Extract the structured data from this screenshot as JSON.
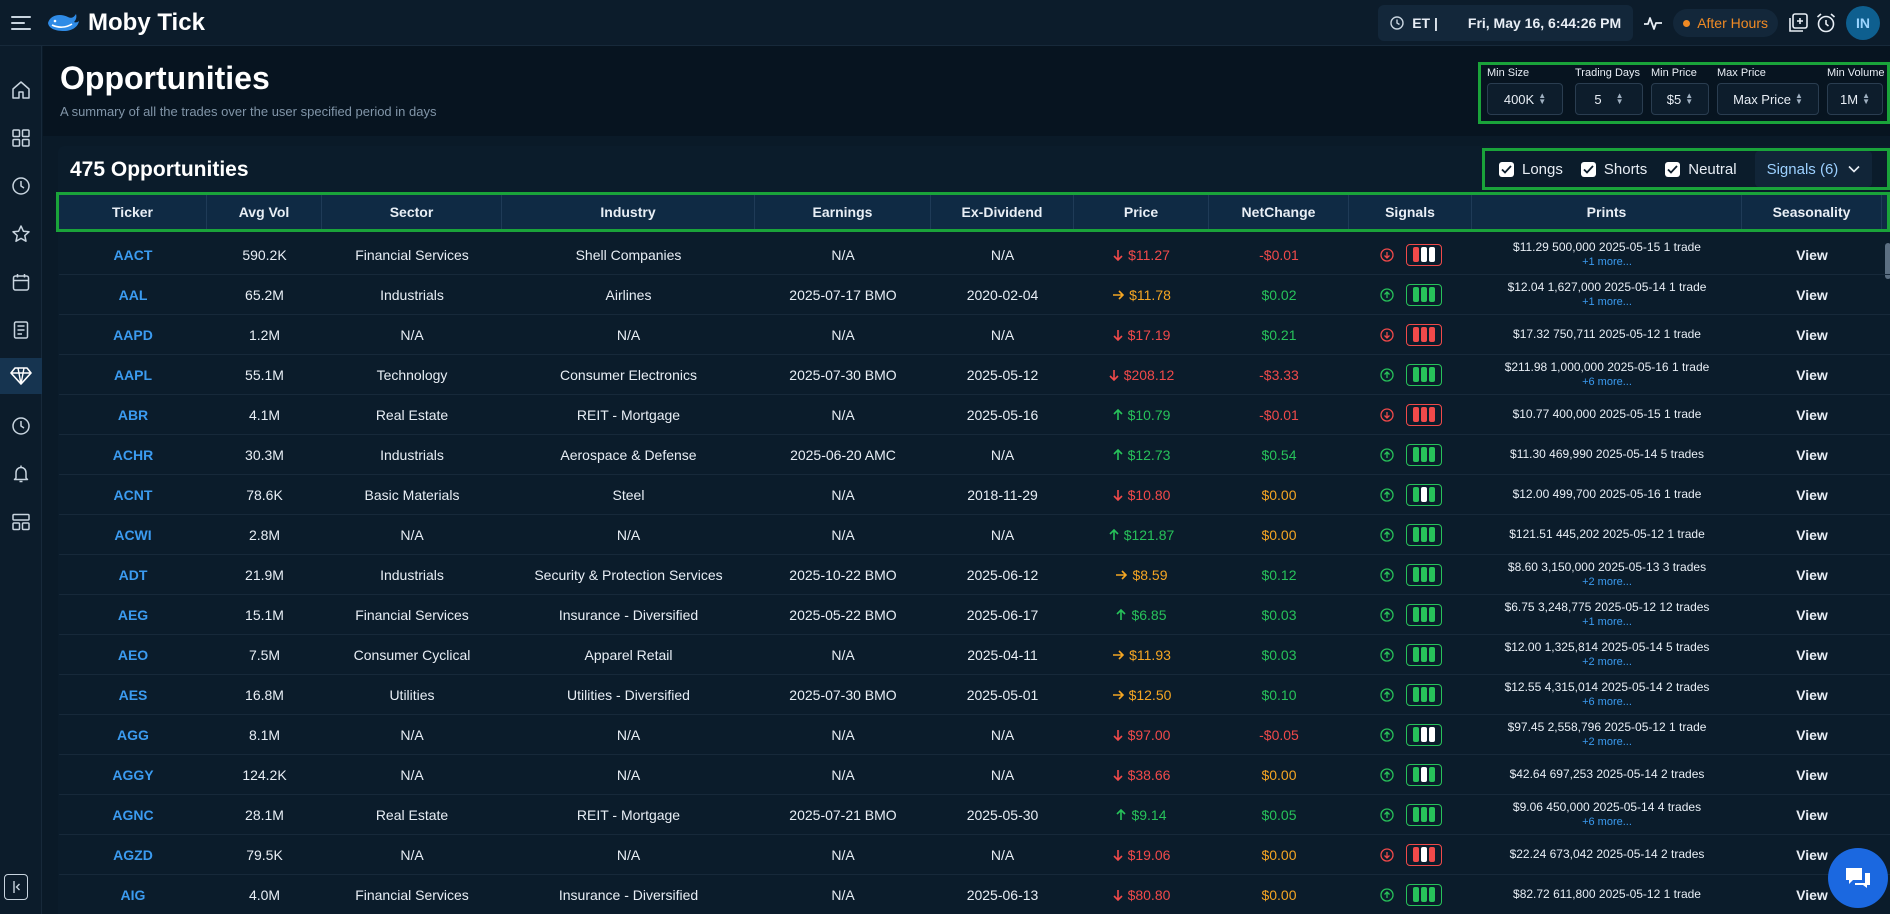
{
  "app": {
    "name": "Moby Tick"
  },
  "topbar": {
    "timezone": "ET |",
    "datetime": "Fri, May 16, 6:44:26 PM",
    "session": "After Hours",
    "avatar_initials": "IN"
  },
  "page": {
    "title": "Opportunities",
    "subtitle": "A summary of all the trades over the user specified period in days"
  },
  "filters": [
    {
      "label": "Min Size",
      "value": "400K"
    },
    {
      "label": "Trading Days",
      "value": "5"
    },
    {
      "label": "Min Price",
      "value": "$5"
    },
    {
      "label": "Max Price",
      "value": "Max Price"
    },
    {
      "label": "Min Volume",
      "value": "1M"
    }
  ],
  "summary": {
    "count_label": "475 Opportunities"
  },
  "toggles": [
    {
      "label": "Longs",
      "checked": true
    },
    {
      "label": "Shorts",
      "checked": true
    },
    {
      "label": "Neutral",
      "checked": true
    }
  ],
  "signals_dropdown": "Signals (6)",
  "columns": [
    "Ticker",
    "Avg Vol",
    "Sector",
    "Industry",
    "Earnings",
    "Ex-Dividend",
    "Price",
    "NetChange",
    "Signals",
    "Prints",
    "Seasonality"
  ],
  "view_label": "View",
  "colors": {
    "accent": "#3b9bf0",
    "up": "#27c25a",
    "down": "#f04a4a",
    "neutral": "#f5a623",
    "highlight": "#1aa33a"
  },
  "rows": [
    {
      "ticker": "AACT",
      "avg_vol": "590.2K",
      "sector": "Financial Services",
      "industry": "Shell Companies",
      "earnings": "N/A",
      "ex_div": "N/A",
      "price": "$11.27",
      "price_dir": "down",
      "net_change": "-$0.01",
      "net_dir": "down",
      "signal": "down",
      "bars": [
        "red",
        "white",
        "white"
      ],
      "print": "$11.29 500,000 2025-05-15 1 trade",
      "more": "+1 more..."
    },
    {
      "ticker": "AAL",
      "avg_vol": "65.2M",
      "sector": "Industrials",
      "industry": "Airlines",
      "earnings": "2025-07-17 BMO",
      "ex_div": "2020-02-04",
      "price": "$11.78",
      "price_dir": "flat",
      "net_change": "$0.02",
      "net_dir": "up",
      "signal": "up",
      "bars": [
        "green",
        "green",
        "green"
      ],
      "print": "$12.04 1,627,000 2025-05-14 1 trade",
      "more": "+1 more..."
    },
    {
      "ticker": "AAPD",
      "avg_vol": "1.2M",
      "sector": "N/A",
      "industry": "N/A",
      "earnings": "N/A",
      "ex_div": "N/A",
      "price": "$17.19",
      "price_dir": "down",
      "net_change": "$0.21",
      "net_dir": "up",
      "signal": "down",
      "bars": [
        "red",
        "red",
        "red"
      ],
      "print": "$17.32 750,711 2025-05-12 1 trade",
      "more": ""
    },
    {
      "ticker": "AAPL",
      "avg_vol": "55.1M",
      "sector": "Technology",
      "industry": "Consumer Electronics",
      "earnings": "2025-07-30 BMO",
      "ex_div": "2025-05-12",
      "price": "$208.12",
      "price_dir": "down",
      "net_change": "-$3.33",
      "net_dir": "down",
      "signal": "up",
      "bars": [
        "green",
        "green",
        "green"
      ],
      "print": "$211.98 1,000,000 2025-05-16 1 trade",
      "more": "+6 more..."
    },
    {
      "ticker": "ABR",
      "avg_vol": "4.1M",
      "sector": "Real Estate",
      "industry": "REIT - Mortgage",
      "earnings": "N/A",
      "ex_div": "2025-05-16",
      "price": "$10.79",
      "price_dir": "up",
      "net_change": "-$0.01",
      "net_dir": "down",
      "signal": "down",
      "bars": [
        "red",
        "red",
        "red"
      ],
      "print": "$10.77 400,000 2025-05-15 1 trade",
      "more": ""
    },
    {
      "ticker": "ACHR",
      "avg_vol": "30.3M",
      "sector": "Industrials",
      "industry": "Aerospace & Defense",
      "earnings": "2025-06-20 AMC",
      "ex_div": "N/A",
      "price": "$12.73",
      "price_dir": "up",
      "net_change": "$0.54",
      "net_dir": "up",
      "signal": "up",
      "bars": [
        "green",
        "green",
        "green"
      ],
      "print": "$11.30 469,990 2025-05-14 5 trades",
      "more": ""
    },
    {
      "ticker": "ACNT",
      "avg_vol": "78.6K",
      "sector": "Basic Materials",
      "industry": "Steel",
      "earnings": "N/A",
      "ex_div": "2018-11-29",
      "price": "$10.80",
      "price_dir": "down",
      "net_change": "$0.00",
      "net_dir": "flat",
      "signal": "up",
      "bars": [
        "green",
        "white",
        "green"
      ],
      "print": "$12.00 499,700 2025-05-16 1 trade",
      "more": ""
    },
    {
      "ticker": "ACWI",
      "avg_vol": "2.8M",
      "sector": "N/A",
      "industry": "N/A",
      "earnings": "N/A",
      "ex_div": "N/A",
      "price": "$121.87",
      "price_dir": "up",
      "net_change": "$0.00",
      "net_dir": "flat",
      "signal": "up",
      "bars": [
        "green",
        "green",
        "green"
      ],
      "print": "$121.51 445,202 2025-05-12 1 trade",
      "more": ""
    },
    {
      "ticker": "ADT",
      "avg_vol": "21.9M",
      "sector": "Industrials",
      "industry": "Security & Protection Services",
      "earnings": "2025-10-22 BMO",
      "ex_div": "2025-06-12",
      "price": "$8.59",
      "price_dir": "flat",
      "net_change": "$0.12",
      "net_dir": "up",
      "signal": "up",
      "bars": [
        "green",
        "green",
        "green"
      ],
      "print": "$8.60 3,150,000 2025-05-13 3 trades",
      "more": "+2 more..."
    },
    {
      "ticker": "AEG",
      "avg_vol": "15.1M",
      "sector": "Financial Services",
      "industry": "Insurance - Diversified",
      "earnings": "2025-05-22 BMO",
      "ex_div": "2025-06-17",
      "price": "$6.85",
      "price_dir": "up",
      "net_change": "$0.03",
      "net_dir": "up",
      "signal": "up",
      "bars": [
        "green",
        "green",
        "green"
      ],
      "print": "$6.75 3,248,775 2025-05-12 12 trades",
      "more": "+1 more..."
    },
    {
      "ticker": "AEO",
      "avg_vol": "7.5M",
      "sector": "Consumer Cyclical",
      "industry": "Apparel Retail",
      "earnings": "N/A",
      "ex_div": "2025-04-11",
      "price": "$11.93",
      "price_dir": "flat",
      "net_change": "$0.03",
      "net_dir": "up",
      "signal": "up",
      "bars": [
        "green",
        "green",
        "green"
      ],
      "print": "$12.00 1,325,814 2025-05-14 5 trades",
      "more": "+2 more..."
    },
    {
      "ticker": "AES",
      "avg_vol": "16.8M",
      "sector": "Utilities",
      "industry": "Utilities - Diversified",
      "earnings": "2025-07-30 BMO",
      "ex_div": "2025-05-01",
      "price": "$12.50",
      "price_dir": "flat",
      "net_change": "$0.10",
      "net_dir": "up",
      "signal": "up",
      "bars": [
        "green",
        "green",
        "green"
      ],
      "print": "$12.55 4,315,014 2025-05-14 2 trades",
      "more": "+6 more..."
    },
    {
      "ticker": "AGG",
      "avg_vol": "8.1M",
      "sector": "N/A",
      "industry": "N/A",
      "earnings": "N/A",
      "ex_div": "N/A",
      "price": "$97.00",
      "price_dir": "down",
      "net_change": "-$0.05",
      "net_dir": "down",
      "signal": "up",
      "bars": [
        "green",
        "white",
        "white"
      ],
      "print": "$97.45 2,558,796 2025-05-12 1 trade",
      "more": "+2 more..."
    },
    {
      "ticker": "AGGY",
      "avg_vol": "124.2K",
      "sector": "N/A",
      "industry": "N/A",
      "earnings": "N/A",
      "ex_div": "N/A",
      "price": "$38.66",
      "price_dir": "down",
      "net_change": "$0.00",
      "net_dir": "flat",
      "signal": "up",
      "bars": [
        "green",
        "white",
        "green"
      ],
      "print": "$42.64 697,253 2025-05-14 2 trades",
      "more": ""
    },
    {
      "ticker": "AGNC",
      "avg_vol": "28.1M",
      "sector": "Real Estate",
      "industry": "REIT - Mortgage",
      "earnings": "2025-07-21 BMO",
      "ex_div": "2025-05-30",
      "price": "$9.14",
      "price_dir": "up",
      "net_change": "$0.05",
      "net_dir": "up",
      "signal": "up",
      "bars": [
        "green",
        "green",
        "green"
      ],
      "print": "$9.06 450,000 2025-05-14 4 trades",
      "more": "+6 more..."
    },
    {
      "ticker": "AGZD",
      "avg_vol": "79.5K",
      "sector": "N/A",
      "industry": "N/A",
      "earnings": "N/A",
      "ex_div": "N/A",
      "price": "$19.06",
      "price_dir": "down",
      "net_change": "$0.00",
      "net_dir": "flat",
      "signal": "down",
      "bars": [
        "red",
        "white",
        "red"
      ],
      "print": "$22.24 673,042 2025-05-14 2 trades",
      "more": ""
    },
    {
      "ticker": "AIG",
      "avg_vol": "4.0M",
      "sector": "Financial Services",
      "industry": "Insurance - Diversified",
      "earnings": "N/A",
      "ex_div": "2025-06-13",
      "price": "$80.80",
      "price_dir": "down",
      "net_change": "$0.00",
      "net_dir": "flat",
      "signal": "up",
      "bars": [
        "green",
        "green",
        "green"
      ],
      "print": "$82.72 611,800 2025-05-12 1 trade",
      "more": ""
    }
  ]
}
